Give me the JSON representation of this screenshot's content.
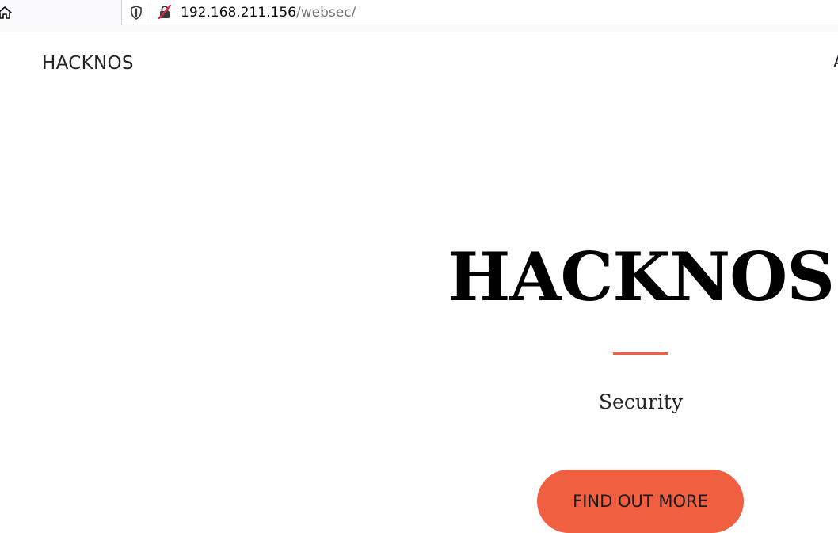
{
  "browser": {
    "url_host": "192.168.211.156",
    "url_path": "/websec/"
  },
  "site": {
    "brand": "HACKNOS",
    "nav_edge_glyph": "A"
  },
  "hero": {
    "title": "HACKNOS",
    "subtitle": "Security",
    "cta_label": "FIND OUT MORE",
    "accent_color": "#f05f40"
  },
  "icons": {
    "home": "home-icon",
    "tracking": "shield-icon",
    "connection": "insecure-connection-icon"
  }
}
